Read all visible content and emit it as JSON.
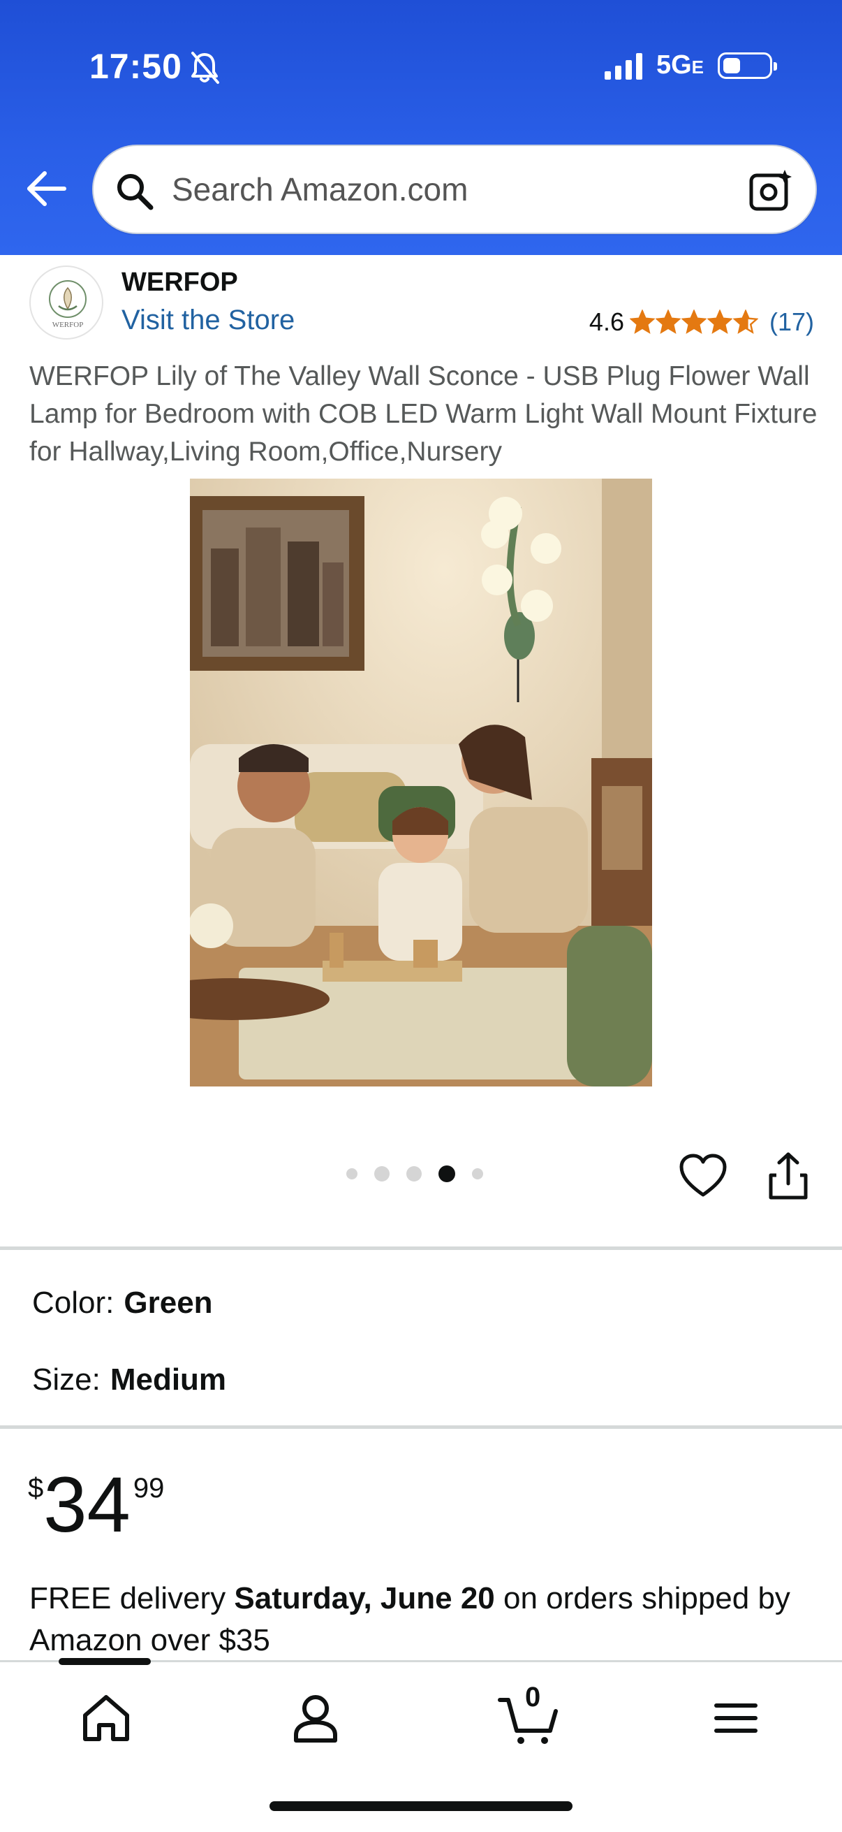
{
  "status_bar": {
    "time": "17:50",
    "network": "5G",
    "network_suffix": "E"
  },
  "search": {
    "placeholder": "Search Amazon.com"
  },
  "brand": {
    "name": "WERFOP",
    "visit_store": "Visit the Store",
    "logo_text": "WERFOP"
  },
  "rating": {
    "value": "4.6",
    "stars": 4.6,
    "count": "(17)",
    "star_color": "#e47911"
  },
  "product": {
    "title": "WERFOP Lily of The Valley Wall Sconce - USB Plug Flower Wall Lamp for Bedroom with COB LED Warm Light Wall Mount Fixture for Hallway,Living Room,Office,Nursery",
    "image_count": 5,
    "active_image": 4
  },
  "options": {
    "color_label": "Color:",
    "color_value": "Green",
    "size_label": "Size:",
    "size_value": "Medium"
  },
  "price": {
    "symbol": "$",
    "whole": "34",
    "fraction": "99"
  },
  "delivery": {
    "prefix": "FREE delivery ",
    "date": "Saturday, June 20",
    "suffix": " on orders shipped by Amazon over $35"
  },
  "bottom_nav": {
    "items": [
      "home-icon",
      "account-icon",
      "cart-icon",
      "menu-icon"
    ],
    "cart_count": "0"
  },
  "colors": {
    "header_blue": "#2a5fe8",
    "link_blue": "#2162a1",
    "accent": "#e47911"
  }
}
